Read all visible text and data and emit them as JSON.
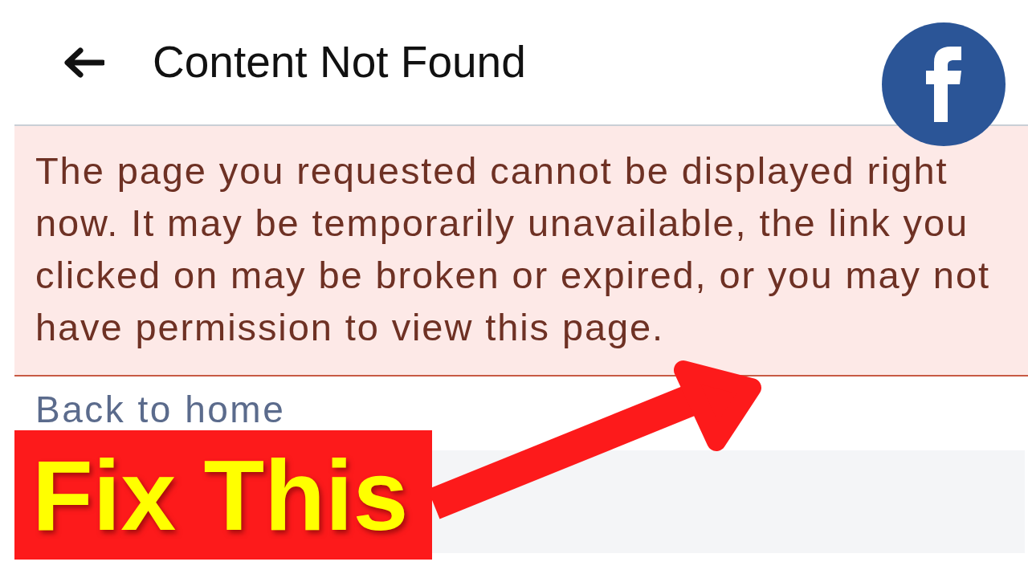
{
  "header": {
    "title": "Content Not Found"
  },
  "error_notice": {
    "message": "The page you requested cannot be displayed right now. It may be temporarily unavailable, the link you clicked on may be broken or expired, or you may not have permission to view this page."
  },
  "back_link": {
    "label": "Back to home"
  },
  "overlay": {
    "banner_text": "Fix This"
  }
}
